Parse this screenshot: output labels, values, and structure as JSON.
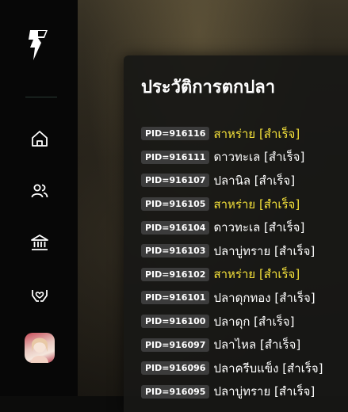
{
  "sidebar": {
    "nav_items": [
      {
        "icon": "home-icon"
      },
      {
        "icon": "users-icon"
      },
      {
        "icon": "bank-icon"
      },
      {
        "icon": "hands-heart-icon"
      }
    ],
    "avatar": "user-avatar"
  },
  "panel": {
    "title": "ประวัติการตกปลา",
    "history": [
      {
        "pid": "PID=916116",
        "label": "สาหร่าย [สำเร็จ]",
        "highlight": true
      },
      {
        "pid": "PID=916111",
        "label": "ดาวทะเล [สำเร็จ]",
        "highlight": false
      },
      {
        "pid": "PID=916107",
        "label": "ปลานิล [สำเร็จ]",
        "highlight": false
      },
      {
        "pid": "PID=916105",
        "label": "สาหร่าย [สำเร็จ]",
        "highlight": true
      },
      {
        "pid": "PID=916104",
        "label": "ดาวทะเล [สำเร็จ]",
        "highlight": false
      },
      {
        "pid": "PID=916103",
        "label": "ปลาบู่ทราย [สำเร็จ]",
        "highlight": false
      },
      {
        "pid": "PID=916102",
        "label": "สาหร่าย [สำเร็จ]",
        "highlight": true
      },
      {
        "pid": "PID=916101",
        "label": "ปลาดุกทอง [สำเร็จ]",
        "highlight": false
      },
      {
        "pid": "PID=916100",
        "label": "ปลาดุก [สำเร็จ]",
        "highlight": false
      },
      {
        "pid": "PID=916097",
        "label": "ปลาไหล [สำเร็จ]",
        "highlight": false
      },
      {
        "pid": "PID=916096",
        "label": "ปลาครีบแข็ง [สำเร็จ]",
        "highlight": false
      },
      {
        "pid": "PID=916095",
        "label": "ปลาบู่ทราย [สำเร็จ]",
        "highlight": false
      }
    ]
  },
  "colors": {
    "highlight": "#f5e23a",
    "text": "#ffffff",
    "pid_badge": "#3c3c3c"
  }
}
